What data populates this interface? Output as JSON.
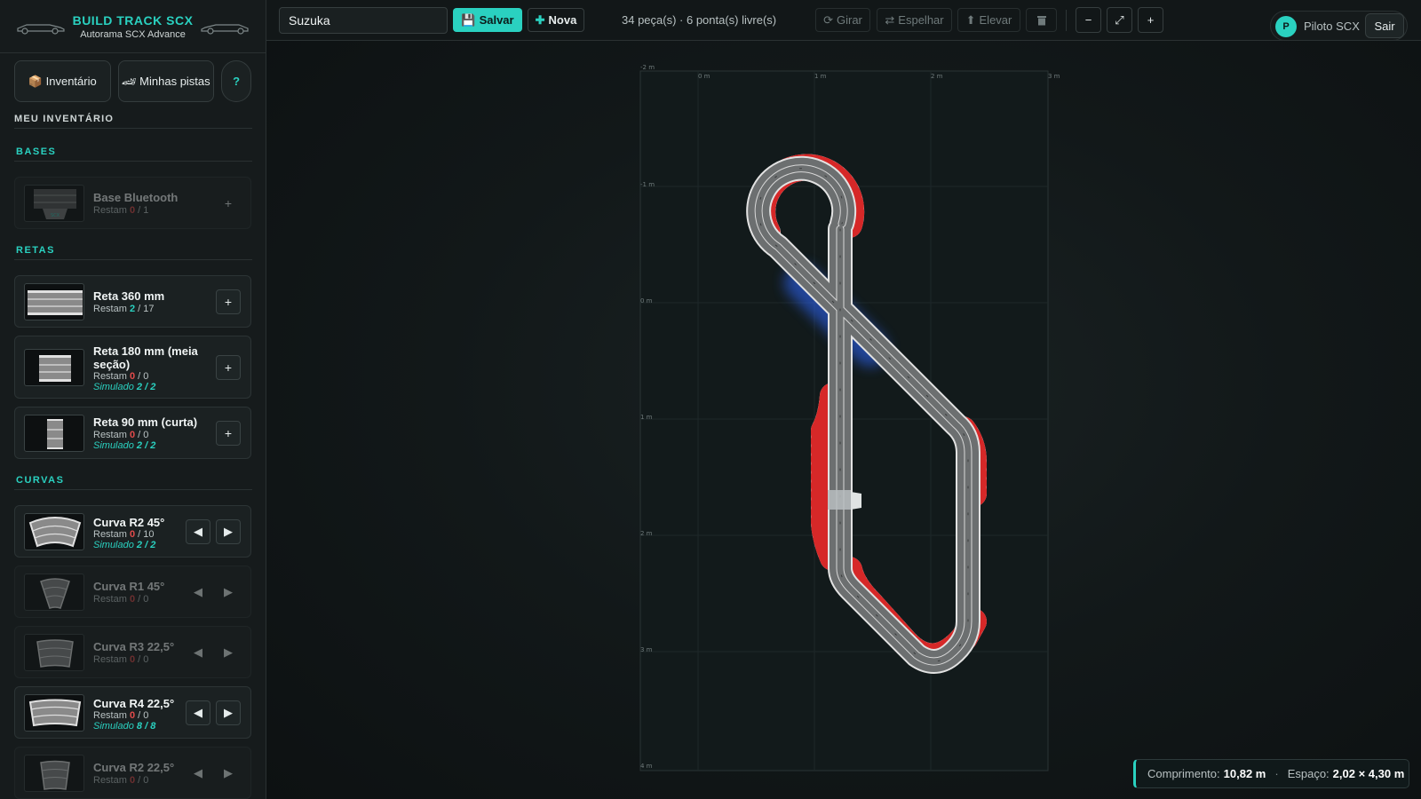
{
  "brand": {
    "title": "BUILD TRACK SCX",
    "subtitle": "Autorama SCX Advance"
  },
  "sidebar": {
    "inventory_button": "📦 Inventário",
    "tracks_button_icon": "🏎",
    "tracks_button_text": "Minhas pistas",
    "help_button": "?",
    "inventory_heading": "MEU INVENTÁRIO",
    "categories": {
      "bases": "BASES",
      "straights": "RETAS",
      "curves": "CURVAS"
    },
    "pieces": {
      "base": {
        "name": "Base Bluetooth",
        "remain_label": "Restam",
        "remain": "0",
        "total": "/ 1",
        "add": "+"
      },
      "reta360": {
        "name": "Reta 360 mm",
        "remain_label": "Restam",
        "remain": "2",
        "total": "/ 17",
        "add": "+"
      },
      "reta180": {
        "name": "Reta 180 mm (meia seção)",
        "remain_label": "Restam",
        "remain": "0",
        "total": "/ 0",
        "sim_label": "Simulado",
        "sim": "2 / 2",
        "add": "+"
      },
      "reta90": {
        "name": "Reta 90 mm (curta)",
        "remain_label": "Restam",
        "remain": "0",
        "total": "/ 0",
        "sim_label": "Simulado",
        "sim": "2 / 2",
        "add": "+"
      },
      "r2_45": {
        "name": "Curva R2 45°",
        "remain_label": "Restam",
        "remain": "0",
        "total": "/ 10",
        "sim_label": "Simulado",
        "sim": "2 / 2",
        "left": "◀",
        "right": "▶"
      },
      "r1_45": {
        "name": "Curva R1 45°",
        "remain_label": "Restam",
        "remain": "0",
        "total": "/ 0",
        "left": "◀",
        "right": "▶"
      },
      "r3_22": {
        "name": "Curva R3 22,5°",
        "remain_label": "Restam",
        "remain": "0",
        "total": "/ 0",
        "left": "◀",
        "right": "▶"
      },
      "r4_22": {
        "name": "Curva R4 22,5°",
        "remain_label": "Restam",
        "remain": "0",
        "total": "/ 0",
        "sim_label": "Simulado",
        "sim": "8 / 8",
        "left": "◀",
        "right": "▶"
      },
      "r2_22": {
        "name": "Curva R2 22,5°",
        "remain_label": "Restam",
        "remain": "0",
        "total": "/ 0",
        "left": "◀",
        "right": "▶"
      }
    }
  },
  "toolbar": {
    "track_name": "Suzuka",
    "save_label": "Salvar",
    "new_label": "Nova",
    "status": "34 peça(s) · 6 ponta(s) livre(s)",
    "rotate_label": "Girar",
    "mirror_label": "Espelhar",
    "raise_label": "Elevar",
    "zoom_out": "−",
    "zoom_fit": "⤢",
    "zoom_in": "+"
  },
  "user": {
    "initial": "P",
    "name": "Piloto SCX",
    "logout_label": "Sair"
  },
  "grid": {
    "x_labels": [
      "-2 m",
      "0 m",
      "1 m",
      "2 m",
      "3 m"
    ],
    "y_labels": [
      "-2 m",
      "-1 m",
      "0 m",
      "1 m",
      "2 m",
      "3 m",
      "4 m"
    ]
  },
  "footer": {
    "length_label": "Comprimento:",
    "length_value": "10,82 m",
    "space_label": "Espaço:",
    "space_value": "2,02 × 4,30 m"
  },
  "colors": {
    "accent": "#2ad1c0",
    "curb_red": "#d62828",
    "danger": "#e24b4b"
  },
  "icons": {
    "save": "floppy-disk-icon",
    "new": "plus-icon",
    "rotate": "rotate-icon",
    "mirror": "mirror-icon",
    "raise": "raise-icon",
    "delete": "trash-icon",
    "fit": "expand-icon"
  }
}
